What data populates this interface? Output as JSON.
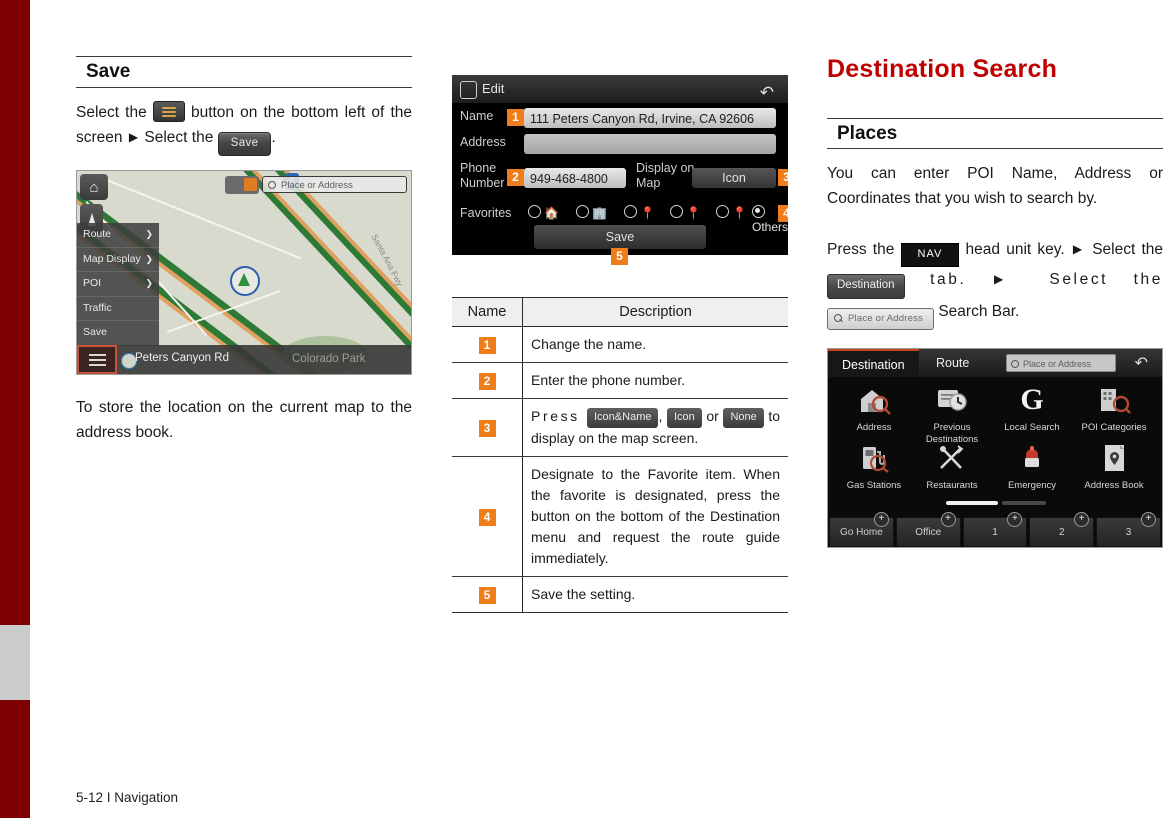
{
  "document": {
    "footer": "5-12 I Navigation",
    "accent_red": "#c00000",
    "spine_red": "#7d0000",
    "badge_orange": "#ef7d1a"
  },
  "left_column": {
    "section_heading": "Save",
    "paragraph1": {
      "part1": "Select the ",
      "part2": " button on the bottom left of the screen ",
      "arrow": "▶",
      "part3": " Select the ",
      "save_button_label": "Save",
      "part4": "."
    },
    "paragraph2": "To store the location on the current map to the address book.",
    "map_screenshot": {
      "name": "map-with-menu",
      "home_icon": "home-icon",
      "compass_icon": "compass-north-icon",
      "search_bar_placeholder": "Place or Address",
      "route_shield": "5",
      "menu_items": [
        {
          "label": "Route",
          "has_arrow": true
        },
        {
          "label": "Map Display",
          "has_arrow": true
        },
        {
          "label": "POI",
          "has_arrow": true
        },
        {
          "label": "Traffic",
          "has_arrow": false
        },
        {
          "label": "Save",
          "has_arrow": false
        }
      ],
      "street_label": "Santa Ana Fwy",
      "bottom_bar": {
        "menu_icon": "hamburger-menu-icon",
        "current_road": "Peters Canyon Rd",
        "place_label": "Colorado Park"
      }
    }
  },
  "middle_column": {
    "edit_screenshot": {
      "title": "Edit",
      "title_icon": "edit-icon",
      "back_icon": "back-arrow-icon",
      "fields": [
        {
          "label": "Name",
          "value": "111 Peters Canyon Rd, Irvine, CA 92606",
          "badge": "1"
        },
        {
          "label": "Address",
          "value": "",
          "badge": ""
        },
        {
          "label": "Phone Number",
          "value": "949-468-4800",
          "badge": "2"
        }
      ],
      "display_on_map_label": "Display on Map",
      "display_on_map_value": "Icon",
      "display_on_map_badge": "3",
      "favorites_label": "Favorites",
      "favorites_badge": "4",
      "favorites_options": [
        {
          "icon": "home-icon",
          "selected": false,
          "label": ""
        },
        {
          "icon": "office-icon",
          "selected": false,
          "label": ""
        },
        {
          "icon": "place-pin-icon",
          "selected": false,
          "label": ""
        },
        {
          "icon": "place-pin-icon",
          "selected": false,
          "label": ""
        },
        {
          "icon": "place-pin-icon",
          "selected": false,
          "label": ""
        },
        {
          "icon": "others-icon",
          "selected": true,
          "label": "Others"
        }
      ],
      "save_button": "Save",
      "save_badge": "5"
    },
    "table": {
      "headers": [
        "Name",
        "Description"
      ],
      "rows": [
        {
          "badge": "1",
          "text": "Change the name."
        },
        {
          "badge": "2",
          "text": "Enter the phone number."
        },
        {
          "badge": "3",
          "rich": {
            "pre": "Press ",
            "btn1": "Icon&Name",
            "mid1": ", ",
            "btn2": "Icon",
            "mid2": " or ",
            "btn3": "None",
            "post": " to display on the map screen."
          }
        },
        {
          "badge": "4",
          "text": "Designate to the Favorite item. When the favorite is designated, press the button on the bottom of the Destination menu and request the route guide immediately."
        },
        {
          "badge": "5",
          "text": "Save the setting."
        }
      ]
    }
  },
  "right_column": {
    "chapter_title": "Destination Search",
    "section_heading": "Places",
    "paragraph1": "You can enter POI Name, Address or Coordinates that you wish to search by.",
    "paragraph2": {
      "part1": "Press the ",
      "nav_key": "NAV",
      "part2": " head unit key. ",
      "arrow": "▶",
      "part3": " Select the ",
      "destination_tab": "Destination",
      "part4": " tab. ",
      "part5": " Select the ",
      "search_bar": "Place or Address",
      "part6": " Search Bar."
    },
    "dest_screenshot": {
      "tabs": [
        {
          "label": "Destination",
          "active": true
        },
        {
          "label": "Route",
          "active": false
        }
      ],
      "search_placeholder": "Place or Address",
      "back_icon": "back-arrow-icon",
      "tiles": [
        {
          "label": "Address",
          "icon": "address-search-icon"
        },
        {
          "label": "Previous Destinations",
          "icon": "previous-destinations-icon"
        },
        {
          "label": "Local Search",
          "icon": "google-local-search-icon"
        },
        {
          "label": "POI Categories",
          "icon": "poi-categories-icon"
        },
        {
          "label": "Gas Stations",
          "icon": "gas-station-icon"
        },
        {
          "label": "Restaurants",
          "icon": "restaurant-icon"
        },
        {
          "label": "Emergency",
          "icon": "emergency-icon"
        },
        {
          "label": "Address Book",
          "icon": "address-book-icon"
        }
      ],
      "quick_buttons": [
        {
          "label": "Go Home",
          "add_icon": "plus-icon"
        },
        {
          "label": "Office",
          "add_icon": "plus-icon"
        },
        {
          "label": "1",
          "add_icon": "plus-icon"
        },
        {
          "label": "2",
          "add_icon": "plus-icon"
        },
        {
          "label": "3",
          "add_icon": "plus-icon"
        }
      ],
      "page_indicator": {
        "current": 1,
        "total": 2
      }
    }
  }
}
